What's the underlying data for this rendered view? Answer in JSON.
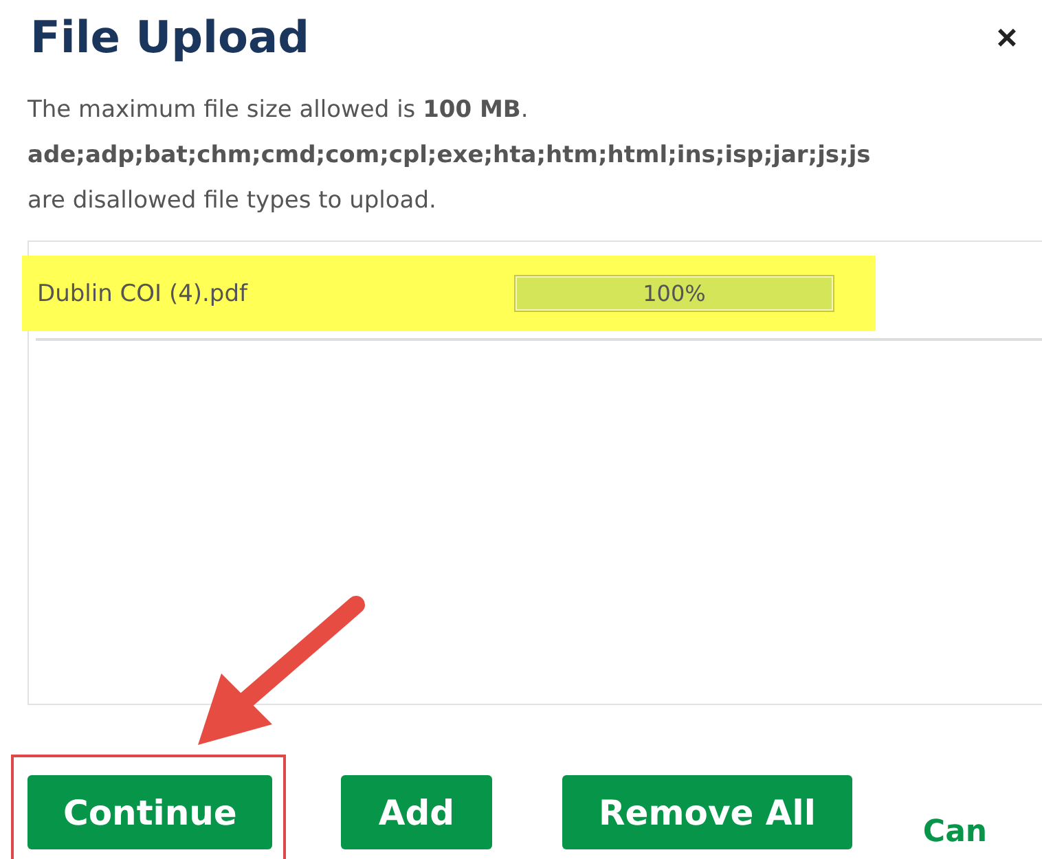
{
  "dialog": {
    "title": "File Upload",
    "close": "×"
  },
  "info": {
    "size_text": "The maximum file size allowed is **100 MB**.",
    "types": "ade;adp;bat;chm;cmd;com;cpl;exe;hta;htm;html;ins;isp;jar;js;js",
    "types_note": "are disallowed file types to upload."
  },
  "files": [
    {
      "name": "Dublin COI (4).pdf",
      "selected": true,
      "level": 1,
      "reading": "100%"
    }
  ],
  "buttons": [
    {
      "label": "Continue",
      "kind": "primary"
    },
    {
      "label": "Add",
      "kind": "primary"
    },
    {
      "label": "Remove All",
      "kind": "primary"
    },
    {
      "label": "Can",
      "kind": "link"
    }
  ]
}
